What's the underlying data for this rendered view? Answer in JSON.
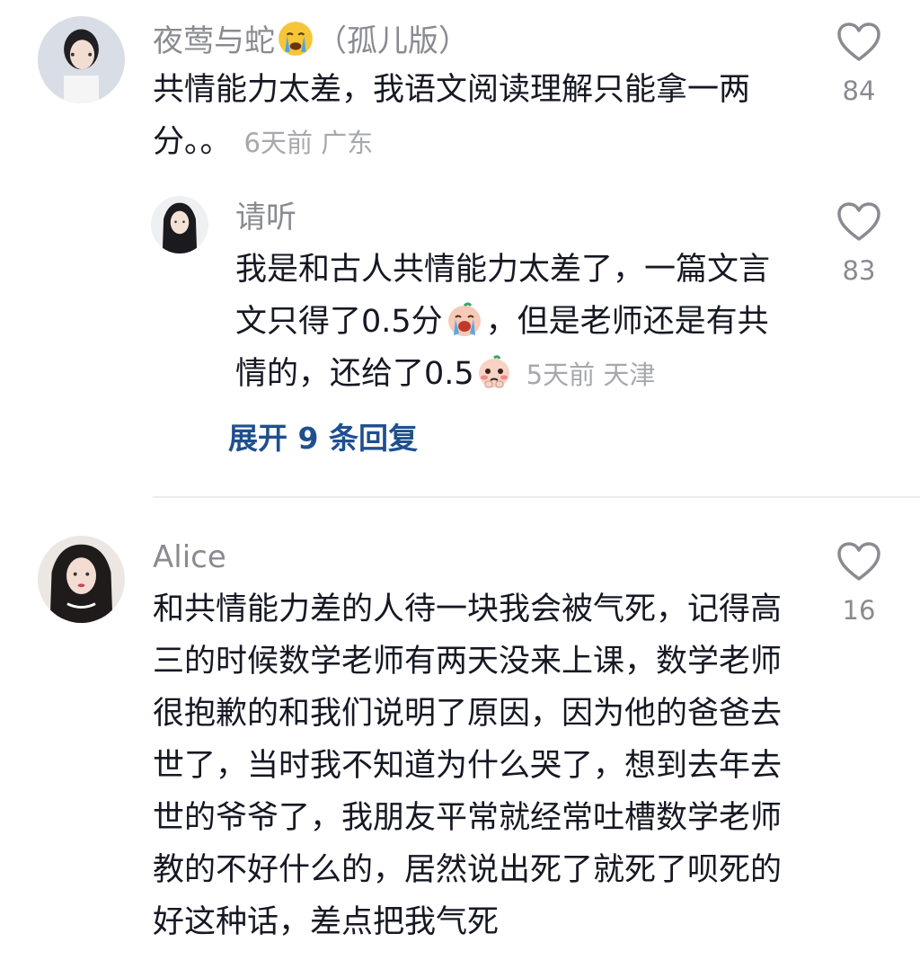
{
  "comments": [
    {
      "username": "夜莺与蛇",
      "username_suffix": "（孤儿版）",
      "name_emoji": "crying-face-emoji",
      "text": "共情能力太差，我语文阅读理解只能拿一两分。。",
      "time": "6天前",
      "location": "广东",
      "likes": "84",
      "reply": {
        "username": "请听",
        "text_part1": "我是和古人共情能力太差了，一篇文言文只得了0.5分",
        "emoji1": "crying-baby-emoji",
        "text_part2": "，但是老师还是有共情的，还给了0.5",
        "emoji2": "pleading-face-emoji",
        "time": "5天前",
        "location": "天津",
        "likes": "83"
      },
      "expand_label": "展开 9 条回复"
    },
    {
      "username": "Alice",
      "text": "和共情能力差的人待一块我会被气死，记得高三的时候数学老师有两天没来上课，数学老师很抱歉的和我们说明了原因，因为他的爸爸去世了，当时我不知道为什么哭了，想到去年去世的爷爷了，我朋友平常就经常吐槽数学老师教的不好什么的，居然说出死了就死了呗死的好这种话，差点把我气死",
      "likes": "16"
    }
  ],
  "colors": {
    "text": "#161823",
    "username": "#8a8b91",
    "meta": "#a7a8ac",
    "link": "#1f4f8f",
    "divider": "#ececec"
  }
}
